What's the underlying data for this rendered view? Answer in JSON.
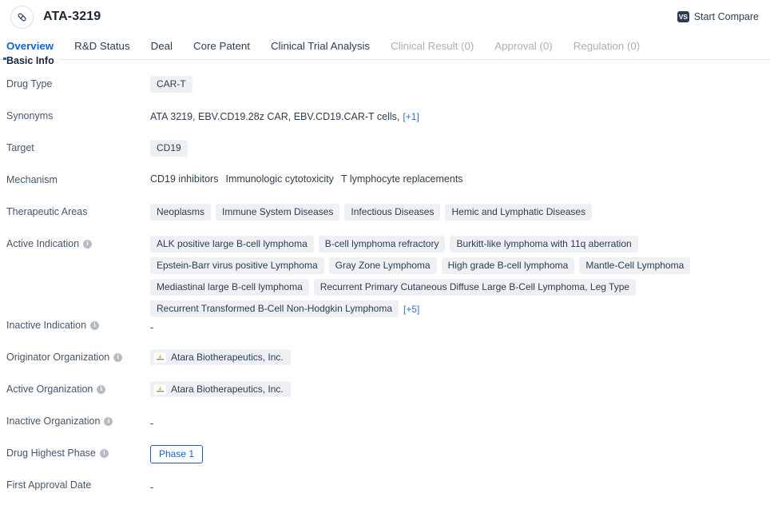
{
  "header": {
    "drug_icon": "pill-capsule-icon",
    "title": "ATA-3219",
    "compare_icon_text": "VS",
    "compare_label": "Start Compare"
  },
  "tabs": [
    {
      "label": "Overview",
      "active": true,
      "disabled": false
    },
    {
      "label": "R&D Status",
      "active": false,
      "disabled": false
    },
    {
      "label": "Deal",
      "active": false,
      "disabled": false
    },
    {
      "label": "Core Patent",
      "active": false,
      "disabled": false
    },
    {
      "label": "Clinical Trial Analysis",
      "active": false,
      "disabled": false
    },
    {
      "label": "Clinical Result (0)",
      "active": false,
      "disabled": true
    },
    {
      "label": "Approval (0)",
      "active": false,
      "disabled": true
    },
    {
      "label": "Regulation (0)",
      "active": false,
      "disabled": true
    }
  ],
  "section": {
    "title": "Basic Info"
  },
  "fields": {
    "drug_type": {
      "label": "Drug Type",
      "tags": [
        "CAR-T"
      ]
    },
    "synonyms": {
      "label": "Synonyms",
      "text": "ATA 3219,  EBV.CD19.28z CAR,  EBV.CD19.CAR-T cells,",
      "more": "[+1]"
    },
    "target": {
      "label": "Target",
      "tags": [
        "CD19"
      ]
    },
    "mechanism": {
      "label": "Mechanism",
      "items": [
        "CD19 inhibitors",
        "Immunologic cytotoxicity",
        "T lymphocyte replacements"
      ]
    },
    "therapeutic_areas": {
      "label": "Therapeutic Areas",
      "tags": [
        "Neoplasms",
        "Immune System Diseases",
        "Infectious Diseases",
        "Hemic and Lymphatic Diseases"
      ]
    },
    "active_indication": {
      "label": "Active Indication",
      "has_info": true,
      "tags": [
        "ALK positive large B-cell lymphoma",
        "B-cell lymphoma refractory",
        "Burkitt-like lymphoma with 11q aberration",
        "Epstein-Barr virus positive Lymphoma",
        "Gray Zone Lymphoma",
        "High grade B-cell lymphoma",
        "Mantle-Cell Lymphoma",
        "Mediastinal large B-cell lymphoma",
        "Recurrent Primary Cutaneous Diffuse Large B-Cell Lymphoma, Leg Type",
        "Recurrent Transformed B-Cell Non-Hodgkin Lymphoma"
      ],
      "more": "[+5]"
    },
    "inactive_indication": {
      "label": "Inactive Indication",
      "has_info": true,
      "value": "-"
    },
    "originator_organization": {
      "label": "Originator Organization",
      "has_info": true,
      "orgs": [
        "Atara Biotherapeutics, Inc."
      ]
    },
    "active_organization": {
      "label": "Active Organization",
      "has_info": true,
      "orgs": [
        "Atara Biotherapeutics, Inc."
      ]
    },
    "inactive_organization": {
      "label": "Inactive Organization",
      "has_info": true,
      "value": "-"
    },
    "drug_highest_phase": {
      "label": "Drug Highest Phase",
      "has_info": true,
      "phase": "Phase 1"
    },
    "first_approval_date": {
      "label": "First Approval Date",
      "has_info": false,
      "value": "-"
    }
  },
  "colors": {
    "accent": "#1263cc",
    "link": "#2f6fd0",
    "tag_bg": "#eef0f3",
    "label": "#44566c",
    "disabled_tab": "#a7b0bb"
  }
}
